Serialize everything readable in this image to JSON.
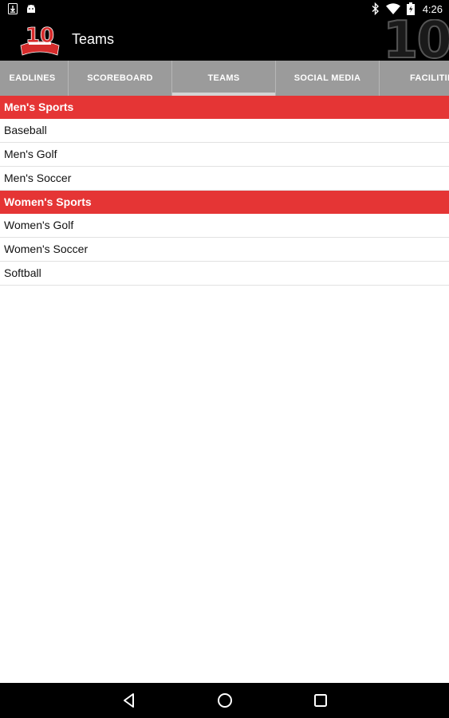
{
  "status_bar": {
    "time": "4:26",
    "icons": [
      "download-icon",
      "android-icon",
      "bluetooth-icon",
      "wifi-icon",
      "battery-charging-icon"
    ]
  },
  "app_bar": {
    "title": "Teams",
    "logo_number": "10",
    "background_number": "10"
  },
  "tabs": [
    {
      "label": "HEADLINES",
      "display": "EADLINES",
      "active": false
    },
    {
      "label": "SCOREBOARD",
      "display": "SCOREBOARD",
      "active": false
    },
    {
      "label": "TEAMS",
      "display": "TEAMS",
      "active": true
    },
    {
      "label": "SOCIAL MEDIA",
      "display": "SOCIAL MEDIA",
      "active": false
    },
    {
      "label": "FACILITIES",
      "display": "FACILITIE",
      "active": false
    }
  ],
  "sections": [
    {
      "header": "Men's Sports",
      "items": [
        "Baseball",
        "Men's Golf",
        "Men's Soccer"
      ]
    },
    {
      "header": "Women's Sports",
      "items": [
        "Women's Golf",
        "Women's Soccer",
        "Softball"
      ]
    }
  ],
  "nav_bar": {
    "buttons": [
      "back-icon",
      "home-icon",
      "recents-icon"
    ]
  },
  "colors": {
    "accent_red": "#e53535",
    "tab_bar": "#9b9b9b",
    "bar_black": "#000000"
  }
}
